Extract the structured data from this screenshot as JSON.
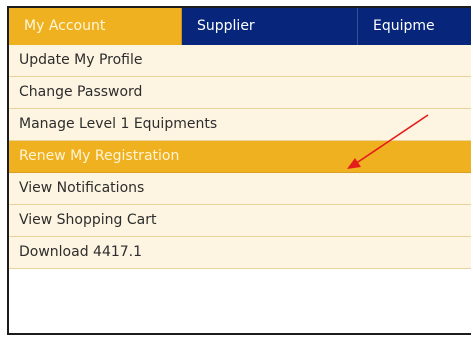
{
  "nav": {
    "tabs": [
      {
        "label": "My Account"
      },
      {
        "label": "Supplier"
      },
      {
        "label": "Equipme"
      }
    ]
  },
  "menu": {
    "items": [
      {
        "label": "Update My Profile"
      },
      {
        "label": "Change Password"
      },
      {
        "label": "Manage Level 1 Equipments"
      },
      {
        "label": "Renew My Registration"
      },
      {
        "label": "View Notifications"
      },
      {
        "label": "View Shopping Cart"
      },
      {
        "label": "Download 4417.1"
      }
    ]
  },
  "colors": {
    "nav_bg": "#07257a",
    "accent": "#efb11f",
    "menu_bg": "#fdf5e2",
    "annotation": "#e51c1c"
  },
  "icons": {
    "annotation": "red-arrow-icon"
  }
}
